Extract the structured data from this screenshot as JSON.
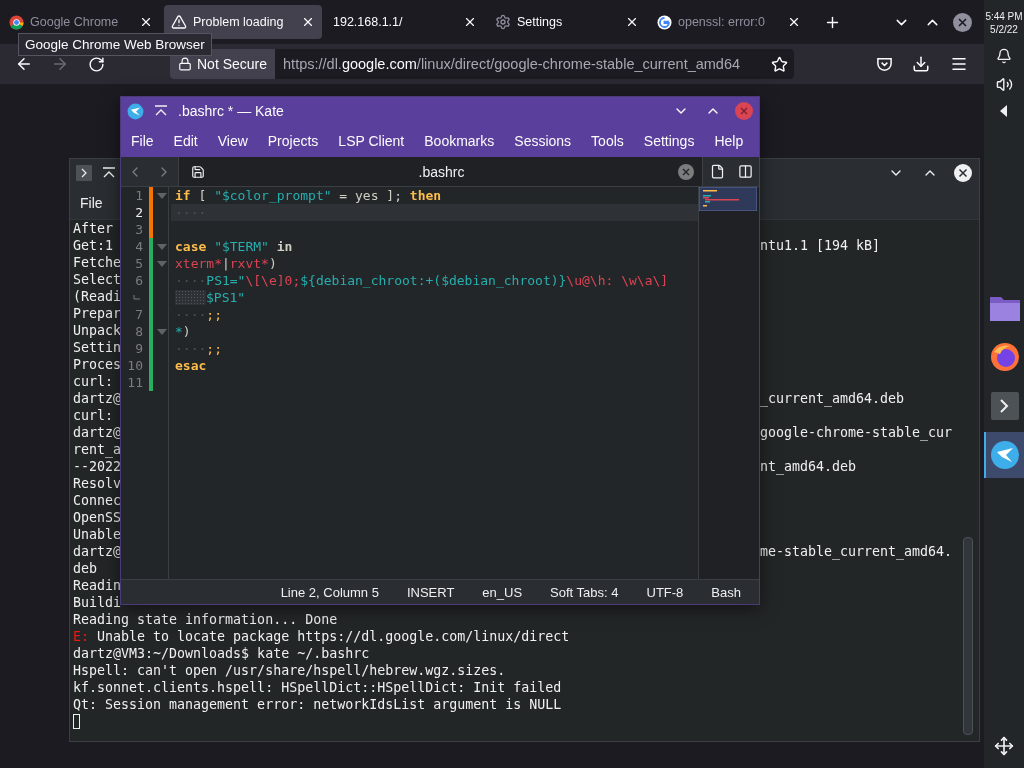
{
  "browser": {
    "tabs": [
      {
        "kind": "chrome",
        "label": "Google Chrome",
        "selected": false,
        "faded": true
      },
      {
        "kind": "warning",
        "label": "Problem loading",
        "selected": true,
        "faded": false
      },
      {
        "kind": "none",
        "label": "192.168.1.1/",
        "selected": false,
        "faded": false
      },
      {
        "kind": "gear",
        "label": "Settings",
        "selected": false,
        "faded": false
      },
      {
        "kind": "google",
        "label": "openssl: error:0",
        "selected": false,
        "faded": true
      }
    ],
    "tooltip": "Google Chrome Web Browser",
    "nav": [
      {
        "kind": "back",
        "disabled": false
      },
      {
        "kind": "forward",
        "disabled": true
      },
      {
        "kind": "reload",
        "disabled": false
      }
    ],
    "security": "Not Secure",
    "url": {
      "scheme": "https://dl.",
      "domain": "google.com",
      "path": "/linux/direct/google-chrome-stable_current_amd64"
    }
  },
  "panel": {
    "time": "5:44 PM",
    "date": "5/2/22",
    "dock": [
      {
        "kind": "folder",
        "selected": false
      },
      {
        "kind": "firefox",
        "selected": false
      },
      {
        "kind": "terminal",
        "selected": false
      },
      {
        "kind": "kate",
        "selected": true
      }
    ]
  },
  "terminal": {
    "menu": [
      "File"
    ],
    "lines": [
      {
        "text": "After"
      },
      {
        "text": "Get:1",
        "right": "ntu1.1 [194 kB]"
      },
      {
        "text": "Fetche"
      },
      {
        "text": "Select"
      },
      {
        "text": "(Readi"
      },
      {
        "text": "Prepar"
      },
      {
        "text": "Unpack"
      },
      {
        "text": "Settin"
      },
      {
        "text": "Proces"
      },
      {
        "text": "curl:"
      },
      {
        "text": "dartz@",
        "right": "_current_amd64.deb"
      },
      {
        "text": "curl:"
      },
      {
        "text": "dartz@",
        "right": "google-chrome-stable_cur"
      },
      {
        "text": "rent_a"
      },
      {
        "text": "--2022",
        "right": "nt_amd64.deb"
      },
      {
        "text": "Resolv"
      },
      {
        "text": "Connec"
      },
      {
        "text": "OpenSS"
      },
      {
        "text": "Unable"
      },
      {
        "text": "dartz@",
        "right": "me-stable_current_amd64."
      },
      {
        "text": "deb"
      },
      {
        "text": "Readin"
      },
      {
        "text": "Buildi"
      },
      {
        "text": "Reading state information... Done"
      },
      {
        "error": "E:",
        "text": " Unable to locate package https://dl.google.com/linux/direct"
      },
      {
        "text": "dartz@VM3:~/Downloads$ kate ~/.bashrc"
      },
      {
        "text": "Hspell: can't open /usr/share/hspell/hebrew.wgz.sizes."
      },
      {
        "text": "kf.sonnet.clients.hspell: HSpellDict::HSpellDict: Init failed"
      },
      {
        "text": "Qt: Session management error: networkIdsList argument is NULL"
      }
    ]
  },
  "kate": {
    "title": ".bashrc * — Kate",
    "menu": [
      "File",
      "Edit",
      "View",
      "Projects",
      "LSP Client",
      "Bookmarks",
      "Sessions",
      "Tools",
      "Settings",
      "Help"
    ],
    "tab": ".bashrc",
    "lines": [
      {
        "number": "1",
        "fold": true,
        "modified": true,
        "current": false,
        "tokens": [
          {
            "kind": "kw",
            "text": "if"
          },
          {
            "kind": "plain",
            "text": " [ "
          },
          {
            "kind": "str",
            "text": "\"$color_prompt\""
          },
          {
            "kind": "plain",
            "text": " = yes ]; "
          },
          {
            "kind": "kw",
            "text": "then"
          }
        ]
      },
      {
        "number": "2",
        "fold": false,
        "modified": true,
        "current": true,
        "tokens": [
          {
            "kind": "ws",
            "text": "····"
          }
        ]
      },
      {
        "number": "3",
        "fold": false,
        "modified": true,
        "current": false
      },
      {
        "number": "4",
        "fold": true,
        "modified": false,
        "current": false,
        "tokens": [
          {
            "kind": "kw",
            "text": "case"
          },
          {
            "kind": "str",
            "text": " \"$TERM\" "
          },
          {
            "kind": "bold",
            "text": "in"
          }
        ]
      },
      {
        "number": "5",
        "fold": true,
        "modified": false,
        "current": false,
        "tokens": [
          {
            "kind": "esc",
            "text": "xterm*"
          },
          {
            "kind": "plain",
            "text": "|"
          },
          {
            "kind": "esc",
            "text": "rxvt*"
          },
          {
            "kind": "plain",
            "text": ")"
          }
        ]
      },
      {
        "number": "6",
        "fold": false,
        "modified": false,
        "current": false,
        "tokens": [
          {
            "kind": "ws",
            "text": "····"
          },
          {
            "kind": "str",
            "text": "PS1=\""
          },
          {
            "kind": "esc",
            "text": "\\[\\e]0;"
          },
          {
            "kind": "str",
            "text": "${debian_chroot:+($debian_chroot)}"
          },
          {
            "kind": "esc",
            "text": "\\u@\\h: \\w\\a\\]"
          }
        ],
        "continuation": [
          {
            "kind": "str",
            "text": "$PS1\""
          }
        ]
      },
      {
        "number": "7",
        "fold": false,
        "modified": false,
        "current": false,
        "tokens": [
          {
            "kind": "ws",
            "text": "····"
          },
          {
            "kind": "punct",
            "text": ";;"
          }
        ]
      },
      {
        "number": "8",
        "fold": true,
        "modified": false,
        "current": false,
        "tokens": [
          {
            "kind": "str",
            "text": "*"
          },
          {
            "kind": "plain",
            "text": ")"
          }
        ]
      },
      {
        "number": "9",
        "fold": false,
        "modified": false,
        "current": false,
        "tokens": [
          {
            "kind": "ws",
            "text": "····"
          },
          {
            "kind": "punct",
            "text": ";;"
          }
        ]
      },
      {
        "number": "10",
        "fold": false,
        "modified": false,
        "current": false,
        "tokens": [
          {
            "kind": "kw",
            "text": "esac"
          }
        ]
      },
      {
        "number": "11",
        "fold": false,
        "modified": false,
        "current": false
      }
    ],
    "status": [
      "Line 2, Column 5",
      "INSERT",
      "en_US",
      "Soft Tabs: 4",
      "UTF-8",
      "Bash"
    ]
  }
}
